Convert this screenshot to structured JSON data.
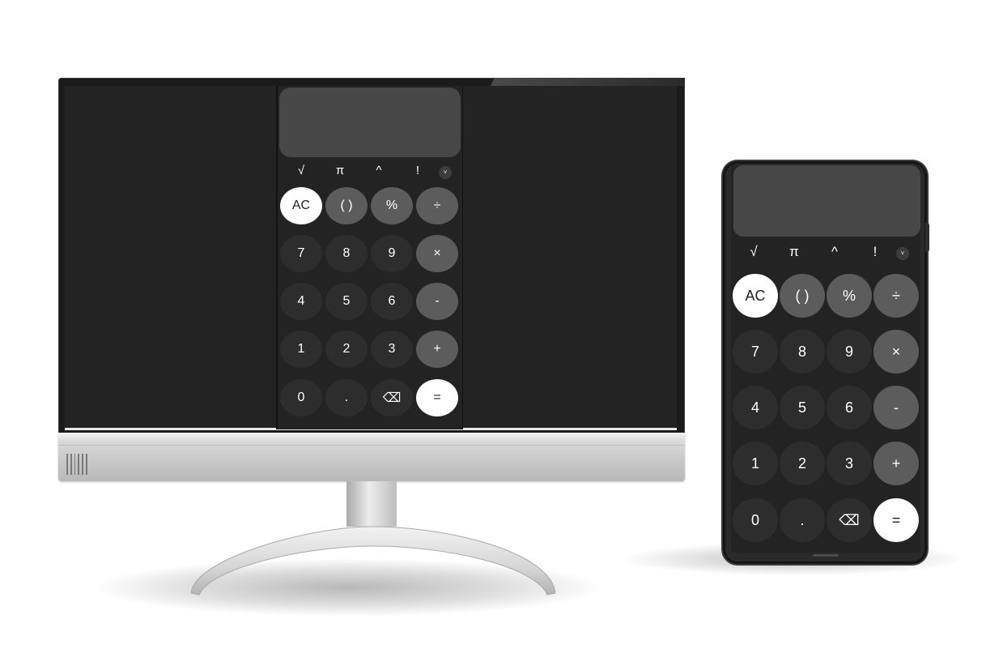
{
  "calculator": {
    "functions": [
      "√",
      "π",
      "^",
      "!"
    ],
    "more_icon": "chevron-down-icon",
    "more_glyph": "˅",
    "rows": [
      [
        {
          "label": "AC",
          "style": "light",
          "name": "clear-button"
        },
        {
          "label": "( )",
          "style": "mid",
          "name": "parentheses-button"
        },
        {
          "label": "%",
          "style": "mid",
          "name": "percent-button"
        },
        {
          "label": "÷",
          "style": "mid",
          "name": "divide-button"
        }
      ],
      [
        {
          "label": "7",
          "style": "dark",
          "name": "digit-7-button"
        },
        {
          "label": "8",
          "style": "dark",
          "name": "digit-8-button"
        },
        {
          "label": "9",
          "style": "dark",
          "name": "digit-9-button"
        },
        {
          "label": "×",
          "style": "mid",
          "name": "multiply-button"
        }
      ],
      [
        {
          "label": "4",
          "style": "dark",
          "name": "digit-4-button"
        },
        {
          "label": "5",
          "style": "dark",
          "name": "digit-5-button"
        },
        {
          "label": "6",
          "style": "dark",
          "name": "digit-6-button"
        },
        {
          "label": "-",
          "style": "mid",
          "name": "subtract-button"
        }
      ],
      [
        {
          "label": "1",
          "style": "dark",
          "name": "digit-1-button"
        },
        {
          "label": "2",
          "style": "dark",
          "name": "digit-2-button"
        },
        {
          "label": "3",
          "style": "dark",
          "name": "digit-3-button"
        },
        {
          "label": "+",
          "style": "mid",
          "name": "add-button"
        }
      ],
      [
        {
          "label": "0",
          "style": "dark",
          "name": "digit-0-button"
        },
        {
          "label": ".",
          "style": "dark",
          "name": "decimal-button"
        },
        {
          "label": "⌫",
          "style": "dark",
          "name": "backspace-button",
          "icon": "backspace-icon"
        },
        {
          "label": "=",
          "style": "light",
          "name": "equals-button"
        }
      ]
    ]
  },
  "colors": {
    "screen_bg": "#232323",
    "display_bg": "#474747",
    "key_dark": "#2d2d2d",
    "key_mid": "#5c5c5c",
    "key_light": "#ffffff"
  }
}
